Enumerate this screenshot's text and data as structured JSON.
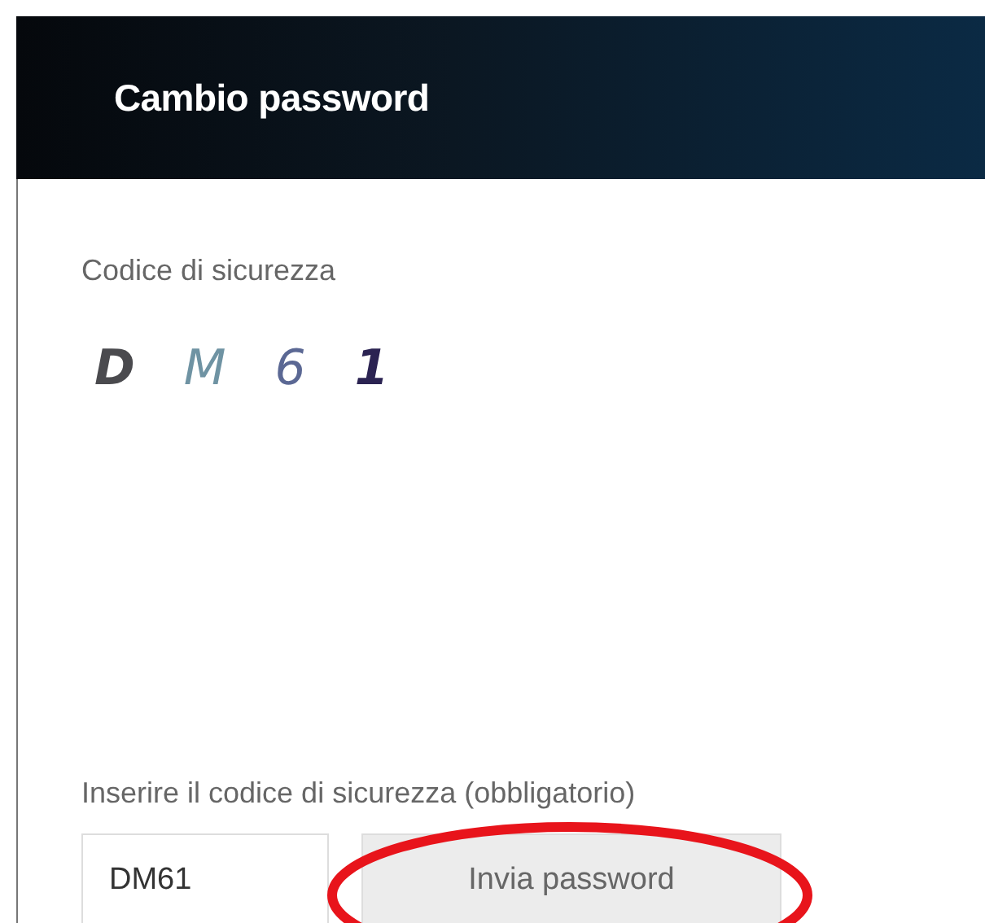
{
  "header": {
    "title": "Cambio password"
  },
  "captcha": {
    "label": "Codice di sicurezza",
    "characters": [
      {
        "char": "D",
        "color": "#4a4a4e",
        "bold": true
      },
      {
        "char": "M",
        "color": "#6f93a3",
        "bold": false
      },
      {
        "char": "6",
        "color": "#5b6894",
        "bold": false
      },
      {
        "char": "1",
        "color": "#2b2352",
        "bold": true
      }
    ]
  },
  "form": {
    "label": "Inserire il codice di sicurezza (obbligatorio)",
    "input_value": "DM61",
    "button": "Invia password",
    "highlighted": true
  }
}
